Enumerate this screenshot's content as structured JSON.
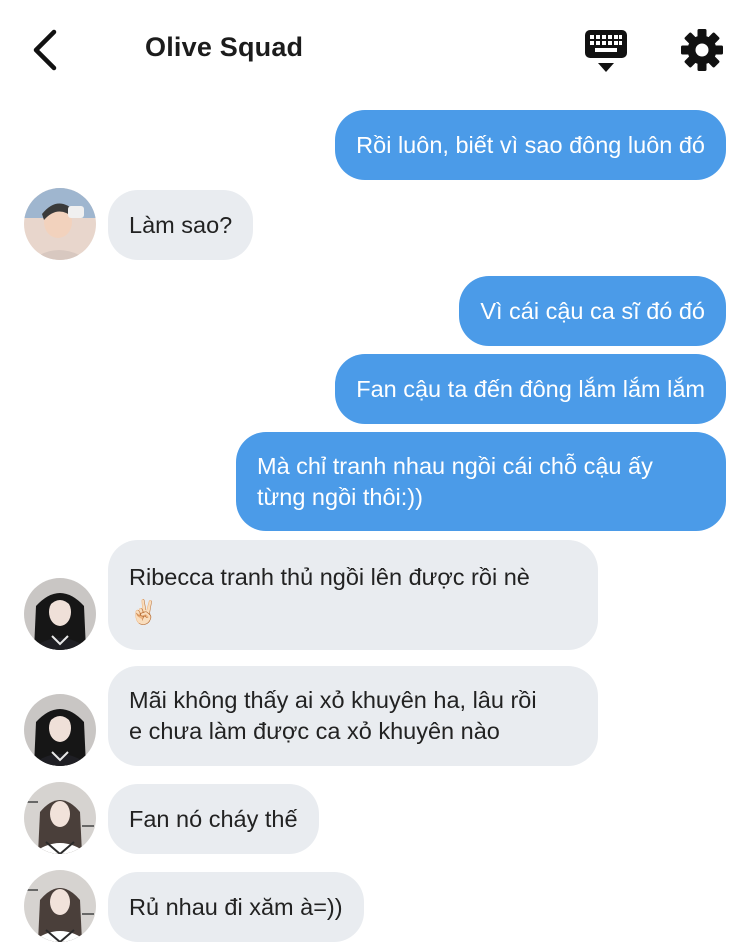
{
  "header": {
    "title": "Olive Squad",
    "back_icon": "chevron-left-icon",
    "keyboard_icon": "keyboard-icon",
    "settings_icon": "gear-icon"
  },
  "colors": {
    "outgoing_bubble": "#4b9be8",
    "incoming_bubble": "#e9ecf0"
  },
  "messages": [
    {
      "direction": "out",
      "text": "Rồi luôn, biết vì sao đông luôn đó"
    },
    {
      "direction": "in",
      "text": "Làm sao?"
    },
    {
      "direction": "out",
      "text": "Vì cái cậu ca sĩ đó đó"
    },
    {
      "direction": "out",
      "text": "Fan cậu ta đến đông lắm lắm lắm"
    },
    {
      "direction": "out",
      "lines": [
        "Mà chỉ tranh nhau ngồi cái chỗ cậu ấy",
        "từng ngồi thôi:))"
      ]
    },
    {
      "direction": "in",
      "lines": [
        "Ribecca tranh thủ ngồi lên được rồi nè",
        "✌🏻"
      ]
    },
    {
      "direction": "in",
      "lines": [
        "Mãi không thấy ai xỏ khuyên ha, lâu rồi",
        "e chưa làm được ca xỏ khuyên nào"
      ]
    },
    {
      "direction": "in",
      "text": "Fan nó cháy thế"
    },
    {
      "direction": "in",
      "text": "Rủ nhau đi xăm à=))"
    }
  ]
}
